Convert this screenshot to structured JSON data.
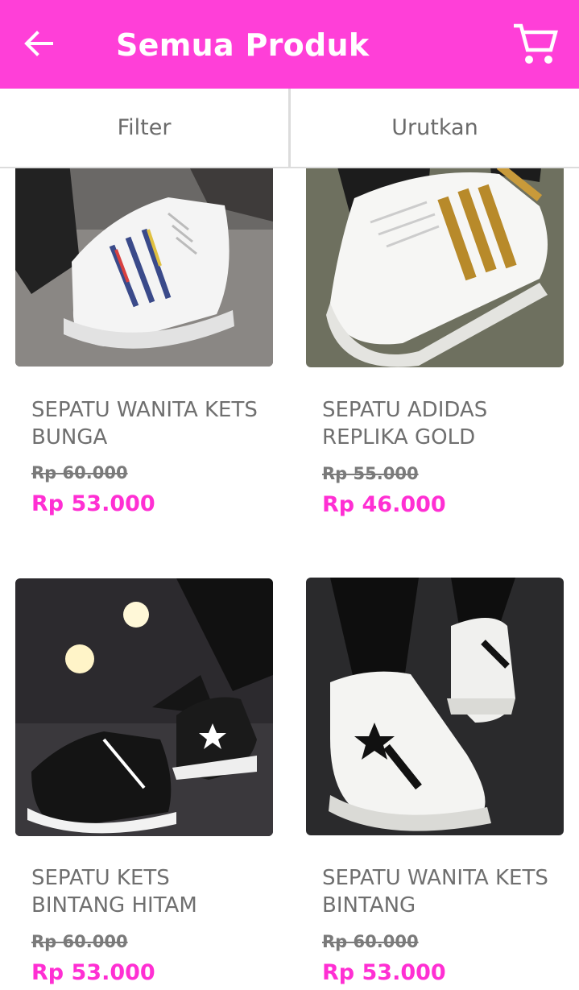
{
  "appbar": {
    "title": "Semua Produk",
    "back_icon": "arrow-left-icon",
    "cart_icon": "shopping-cart-icon",
    "color": "#ff3fd8"
  },
  "toolbar": {
    "filter_label": "Filter",
    "sort_label": "Urutkan"
  },
  "products": [
    {
      "name": "SEPATU WANITA KETS BUNGA",
      "old_price": "Rp 60.000",
      "price": "Rp 53.000",
      "image": "white sneaker with floral stripes"
    },
    {
      "name": "SEPATU ADIDAS REPLIKA GOLD",
      "old_price": "Rp 55.000",
      "price": "Rp 46.000",
      "image": "white sneaker with gold stripes"
    },
    {
      "name": "SEPATU KETS BINTANG HITAM",
      "old_price": "Rp 60.000",
      "price": "Rp 53.000",
      "image": "black sneaker with white star"
    },
    {
      "name": "SEPATU WANITA KETS BINTANG",
      "old_price": "Rp 60.000",
      "price": "Rp 53.000",
      "image": "white sneaker with black star"
    }
  ],
  "colors": {
    "accent": "#ff2fd3",
    "text": "#6f6f6f"
  }
}
